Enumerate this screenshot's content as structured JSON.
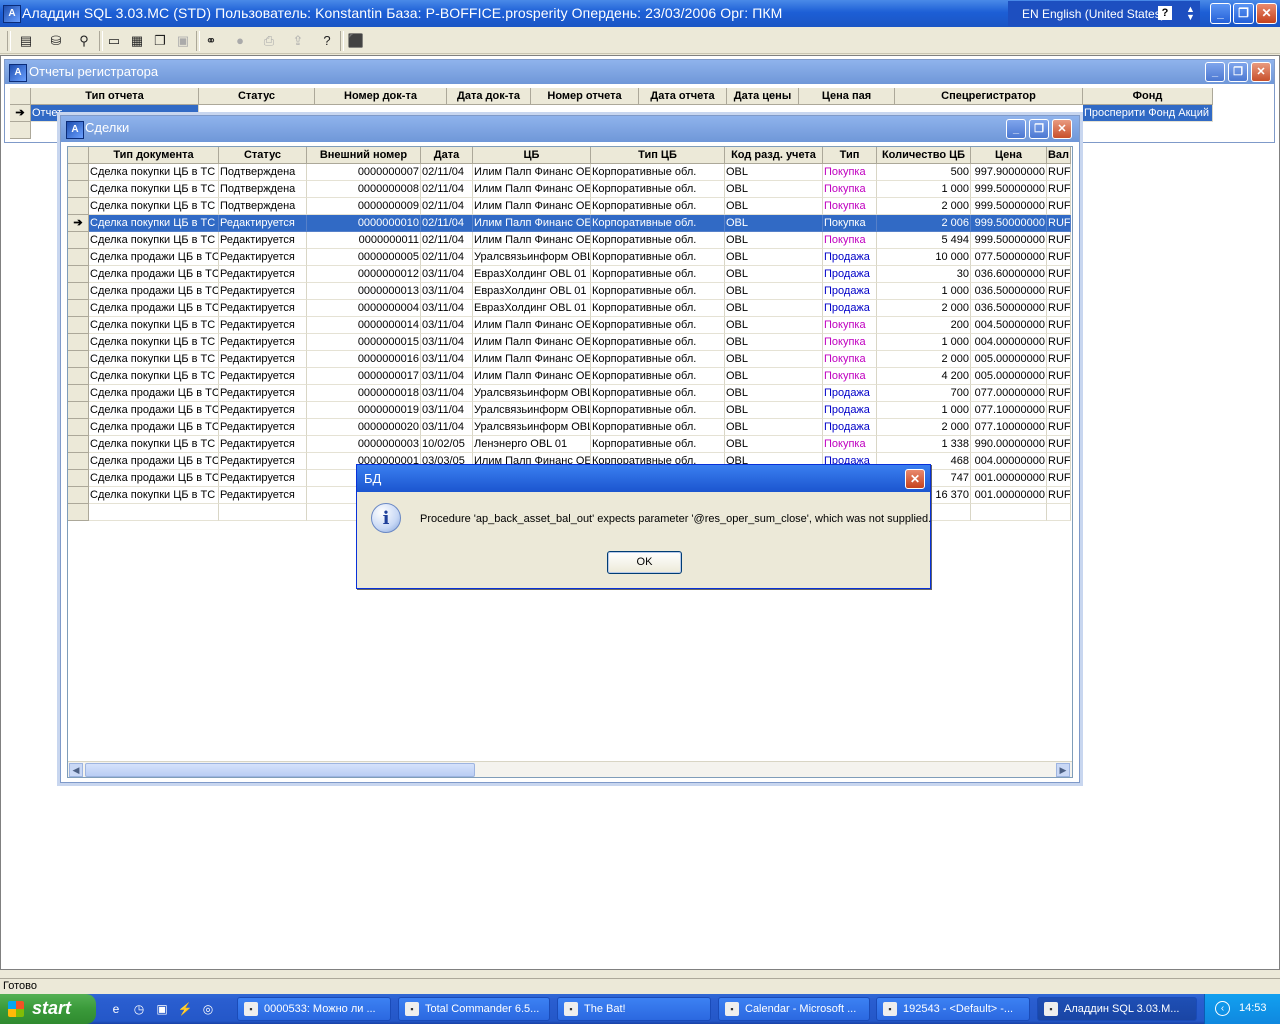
{
  "app": {
    "title": "Аладдин SQL 3.03.MC (STD)  Пользователь: Konstantin База: P-BOFFICE.prosperity Опердень: 23/03/2006 Орг: ПКМ",
    "lang": "EN English (United States)",
    "help_glyph": "?",
    "minimize": "_",
    "restore": "❐",
    "close": "✕"
  },
  "toolbar": {
    "icons": [
      "report-icon",
      "database-icon",
      "filter-icon",
      "window-icon",
      "tile-icon",
      "cascade-icon",
      "arrange-icon",
      "binoculars-icon",
      "stop-icon",
      "print-icon",
      "export-icon",
      "help-icon",
      "exit-icon"
    ]
  },
  "reports_window": {
    "title": "Отчеты регистратора",
    "columns": [
      "Тип отчета",
      "Статус",
      "Номер док-та",
      "Дата док-та",
      "Номер отчета",
      "Дата отчета",
      "Дата цены",
      "Цена пая",
      "Спецрегистратор",
      "Фонд"
    ],
    "row": {
      "type": "Отчет",
      "fund": "Просперити Фонд Акций"
    }
  },
  "deals_window": {
    "title": "Сделки",
    "columns": [
      "Тип документа",
      "Статус",
      "Внешний номер",
      "Дата",
      "ЦБ",
      "Тип ЦБ",
      "Код разд. учета",
      "Тип",
      "Количество ЦБ",
      "Цена",
      "Вал"
    ],
    "rows": [
      [
        "Сделка покупки ЦБ в ТС",
        "Подтверждена",
        "0000000007",
        "02/11/04",
        "Илим Палп Финанс OE",
        "Корпоративные обл.",
        "OBL",
        "Покупка",
        "500",
        "997.90000000",
        "RUF"
      ],
      [
        "Сделка покупки ЦБ в ТС",
        "Подтверждена",
        "0000000008",
        "02/11/04",
        "Илим Палп Финанс OE",
        "Корпоративные обл.",
        "OBL",
        "Покупка",
        "1 000",
        "999.50000000",
        "RUF"
      ],
      [
        "Сделка покупки ЦБ в ТС",
        "Подтверждена",
        "0000000009",
        "02/11/04",
        "Илим Палп Финанс OE",
        "Корпоративные обл.",
        "OBL",
        "Покупка",
        "2 000",
        "999.50000000",
        "RUF"
      ],
      [
        "Сделка покупки ЦБ в ТС",
        "Редактируется",
        "0000000010",
        "02/11/04",
        "Илим Палп Финанс OE",
        "Корпоративные обл.",
        "OBL",
        "Покупка",
        "2 006",
        "999.50000000",
        "RUF"
      ],
      [
        "Сделка покупки ЦБ в ТС",
        "Редактируется",
        "0000000011",
        "02/11/04",
        "Илим Палп Финанс OE",
        "Корпоративные обл.",
        "OBL",
        "Покупка",
        "5 494",
        "999.50000000",
        "RUF"
      ],
      [
        "Сделка продажи ЦБ в ТС",
        "Редактируется",
        "0000000005",
        "02/11/04",
        "Уралсвязьинформ OBL",
        "Корпоративные обл.",
        "OBL",
        "Продажа",
        "10 000",
        "077.50000000",
        "RUF"
      ],
      [
        "Сделка продажи ЦБ в ТС",
        "Редактируется",
        "0000000012",
        "03/11/04",
        "ЕвразХолдинг OBL  01",
        "Корпоративные обл.",
        "OBL",
        "Продажа",
        "30",
        "036.60000000",
        "RUF"
      ],
      [
        "Сделка продажи ЦБ в ТС",
        "Редактируется",
        "0000000013",
        "03/11/04",
        "ЕвразХолдинг OBL  01",
        "Корпоративные обл.",
        "OBL",
        "Продажа",
        "1 000",
        "036.50000000",
        "RUF"
      ],
      [
        "Сделка продажи ЦБ в ТС",
        "Редактируется",
        "0000000004",
        "03/11/04",
        "ЕвразХолдинг OBL  01",
        "Корпоративные обл.",
        "OBL",
        "Продажа",
        "2 000",
        "036.50000000",
        "RUF"
      ],
      [
        "Сделка покупки ЦБ в ТС",
        "Редактируется",
        "0000000014",
        "03/11/04",
        "Илим Палп Финанс OE",
        "Корпоративные обл.",
        "OBL",
        "Покупка",
        "200",
        "004.50000000",
        "RUF"
      ],
      [
        "Сделка покупки ЦБ в ТС",
        "Редактируется",
        "0000000015",
        "03/11/04",
        "Илим Палп Финанс OE",
        "Корпоративные обл.",
        "OBL",
        "Покупка",
        "1 000",
        "004.00000000",
        "RUF"
      ],
      [
        "Сделка покупки ЦБ в ТС",
        "Редактируется",
        "0000000016",
        "03/11/04",
        "Илим Палп Финанс OE",
        "Корпоративные обл.",
        "OBL",
        "Покупка",
        "2 000",
        "005.00000000",
        "RUF"
      ],
      [
        "Сделка покупки ЦБ в ТС",
        "Редактируется",
        "0000000017",
        "03/11/04",
        "Илим Палп Финанс OE",
        "Корпоративные обл.",
        "OBL",
        "Покупка",
        "4 200",
        "005.00000000",
        "RUF"
      ],
      [
        "Сделка продажи ЦБ в ТС",
        "Редактируется",
        "0000000018",
        "03/11/04",
        "Уралсвязьинформ OBL",
        "Корпоративные обл.",
        "OBL",
        "Продажа",
        "700",
        "077.00000000",
        "RUF"
      ],
      [
        "Сделка продажи ЦБ в ТС",
        "Редактируется",
        "0000000019",
        "03/11/04",
        "Уралсвязьинформ OBL",
        "Корпоративные обл.",
        "OBL",
        "Продажа",
        "1 000",
        "077.10000000",
        "RUF"
      ],
      [
        "Сделка продажи ЦБ в ТС",
        "Редактируется",
        "0000000020",
        "03/11/04",
        "Уралсвязьинформ OBL",
        "Корпоративные обл.",
        "OBL",
        "Продажа",
        "2 000",
        "077.10000000",
        "RUF"
      ],
      [
        "Сделка покупки ЦБ в ТС",
        "Редактируется",
        "0000000003",
        "10/02/05",
        "Ленэнерго OBL 01",
        "Корпоративные обл.",
        "OBL",
        "Покупка",
        "1 338",
        "990.00000000",
        "RUF"
      ],
      [
        "Сделка продажи ЦБ в ТС",
        "Редактируется",
        "0000000001",
        "03/03/05",
        "Илим Палп Финанс OE",
        "Корпоративные обл.",
        "OBL",
        "Продажа",
        "468",
        "004.00000000",
        "RUF"
      ],
      [
        "Сделка продажи ЦБ в ТС",
        "Редактируется",
        "",
        "",
        "",
        "",
        "",
        "",
        "747",
        "001.00000000",
        "RUF"
      ],
      [
        "Сделка покупки ЦБ в ТС",
        "Редактируется",
        "",
        "",
        "",
        "",
        "",
        "",
        "16 370",
        "001.00000000",
        "RUF"
      ]
    ],
    "selected_row": 3
  },
  "dialog": {
    "title": "БД",
    "message": "Procedure 'ap_back_asset_bal_out' expects parameter '@res_oper_sum_close', which was not supplied.",
    "ok": "OK",
    "icon_glyph": "i"
  },
  "status": {
    "text": "Готово"
  },
  "taskbar": {
    "start": "start",
    "tasks": [
      {
        "label": "0000533: Можно ли ...",
        "icon": "mantis-icon"
      },
      {
        "label": "Total Commander 6.5...",
        "icon": "total-commander-icon"
      },
      {
        "label": "The Bat!",
        "icon": "the-bat-icon"
      },
      {
        "label": "Calendar - Microsoft ...",
        "icon": "outlook-icon"
      },
      {
        "label": "192543 - <Default> -...",
        "icon": "terminal-icon"
      },
      {
        "label": "Аладдин SQL 3.03.M...",
        "icon": "aladdin-icon"
      }
    ],
    "clock": "14:53"
  }
}
